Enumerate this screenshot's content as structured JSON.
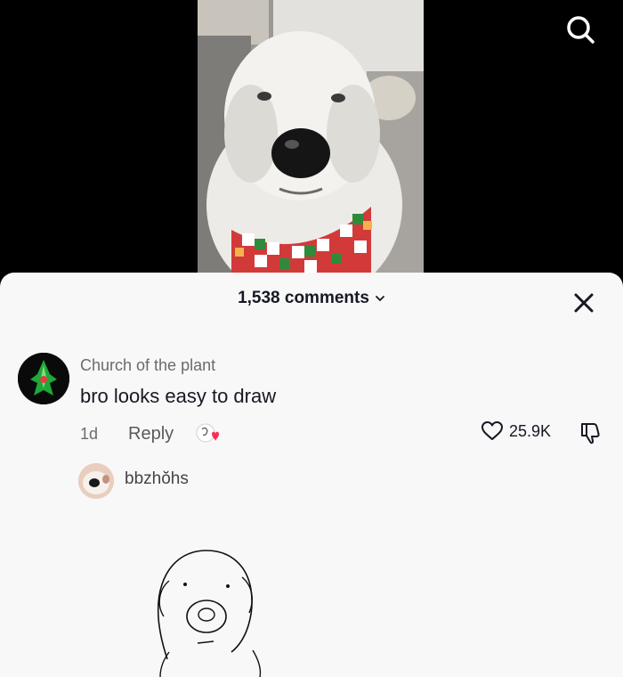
{
  "video": {
    "icon": "dog-photo"
  },
  "topbar": {
    "search_icon": "search-icon"
  },
  "comments_sheet": {
    "count_label": "1,538 comments",
    "close_icon": "close-icon"
  },
  "comment": {
    "username": "Church of the plant",
    "text": "bro looks easy to draw",
    "age": "1d",
    "reply_label": "Reply",
    "likes": "25.9K"
  },
  "reply": {
    "username": "bbzhŏhs",
    "image_icon": "dog-line-drawing"
  },
  "colors": {
    "sheet_bg": "#f8f8f8",
    "text_primary": "#161823",
    "text_secondary": "#6b6b6b",
    "heart_red": "#fe2c55"
  }
}
